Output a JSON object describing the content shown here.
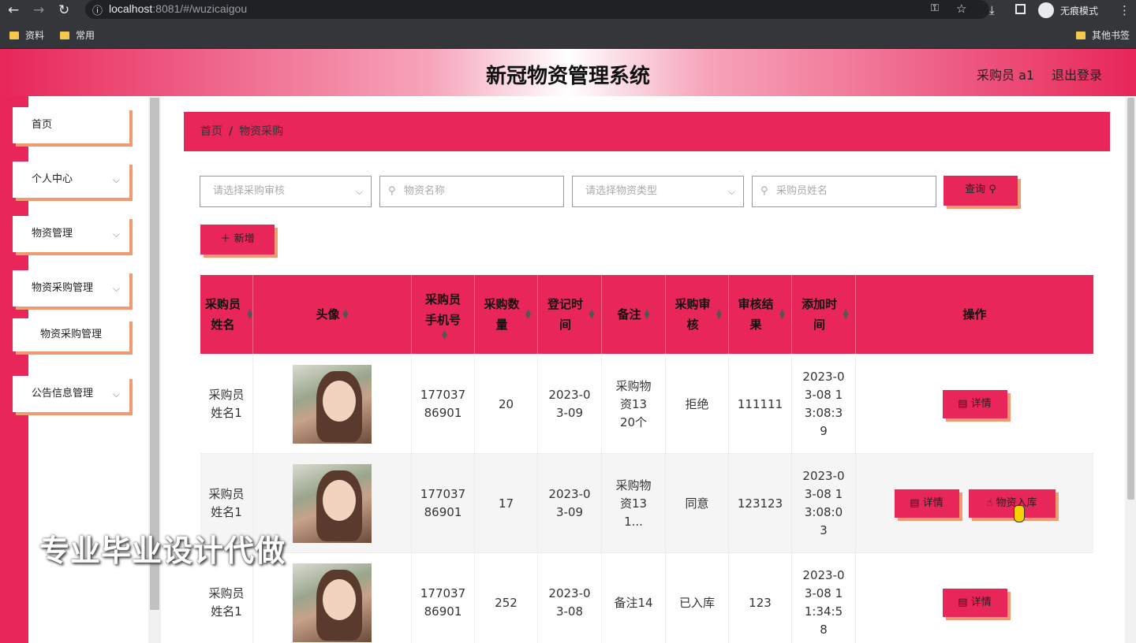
{
  "browser": {
    "url_host": "localhost",
    "url_rest": ":8081/#/wuzicaigou",
    "incognito_label": "无痕模式",
    "bookmarks": [
      "资料",
      "常用"
    ],
    "other_bookmarks": "其他书签"
  },
  "header": {
    "title": "新冠物资管理系统",
    "user_label": "采购员 a1",
    "logout_label": "退出登录"
  },
  "sidebar": {
    "items": [
      {
        "label": "首页"
      },
      {
        "label": "个人中心"
      },
      {
        "label": "物资管理"
      },
      {
        "label": "物资采购管理"
      },
      {
        "label": "公告信息管理"
      }
    ],
    "submenu_label": "物资采购管理"
  },
  "breadcrumb": {
    "home": "首页",
    "separator": "/",
    "current": "物资采购"
  },
  "filters": {
    "review_placeholder": "请选择采购审核",
    "name_placeholder": "物资名称",
    "type_placeholder": "请选择物资类型",
    "buyer_placeholder": "采购员姓名",
    "query_label": "查询"
  },
  "add_label": "新增",
  "table": {
    "headers": [
      "采购员姓名",
      "头像",
      "采购员手机号",
      "采购数量",
      "登记时间",
      "备注",
      "采购审核",
      "审核结果",
      "添加时间",
      "操作"
    ],
    "rows": [
      {
        "name": "采购员姓名1",
        "phone": "17703786901",
        "qty": "20",
        "reg": "2023-03-09",
        "note": "采购物资13 20个",
        "review": "拒绝",
        "result": "111111",
        "added": "2023-03-08 13:08:39",
        "actions": [
          "详情"
        ]
      },
      {
        "name": "采购员姓名1",
        "phone": "17703786901",
        "qty": "17",
        "reg": "2023-03-09",
        "note": "采购物资13 1...",
        "review": "同意",
        "result": "123123",
        "added": "2023-03-08 13:08:03",
        "actions": [
          "详情",
          "物资入库"
        ]
      },
      {
        "name": "采购员姓名1",
        "phone": "17703786901",
        "qty": "252",
        "reg": "2023-03-08",
        "note": "备注14",
        "review": "已入库",
        "result": "123",
        "added": "2023-03-08 11:34:58",
        "actions": [
          "详情"
        ]
      }
    ]
  },
  "watermark": "专业毕业设计代做",
  "colors": {
    "accent": "#e8265a",
    "shadow": "#f09a72"
  }
}
